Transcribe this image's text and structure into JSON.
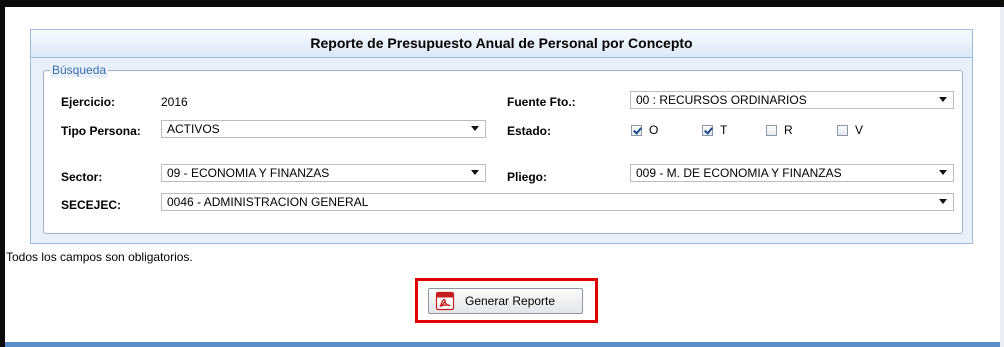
{
  "panel": {
    "title": "Reporte de Presupuesto Anual de Personal por Concepto",
    "legend": "Búsqueda"
  },
  "fields": {
    "ejercicio": {
      "label": "Ejercicio:",
      "value": "2016"
    },
    "fuente": {
      "label": "Fuente Fto.:",
      "value": "00 : RECURSOS ORDINARIOS"
    },
    "tipo_persona": {
      "label": "Tipo Persona:",
      "value": "ACTIVOS"
    },
    "estado": {
      "label": "Estado:",
      "options": [
        {
          "label": "O",
          "checked": true
        },
        {
          "label": "T",
          "checked": true
        },
        {
          "label": "R",
          "checked": false
        },
        {
          "label": "V",
          "checked": false
        }
      ]
    },
    "sector": {
      "label": "Sector:",
      "value": "09 - ECONOMIA Y FINANZAS"
    },
    "pliego": {
      "label": "Pliego:",
      "value": "009 - M. DE ECONOMIA Y FINANZAS"
    },
    "secejec": {
      "label": "SECEJEC:",
      "value": "0046 - ADMINISTRACION GENERAL"
    }
  },
  "note": "Todos los campos son obligatorios.",
  "button": {
    "label": "Generar Reporte",
    "icon": "pdf-icon"
  },
  "colors": {
    "accent": "#e00000",
    "panel_bg": "#e8f1fb",
    "legend_text": "#3b6cb0"
  }
}
